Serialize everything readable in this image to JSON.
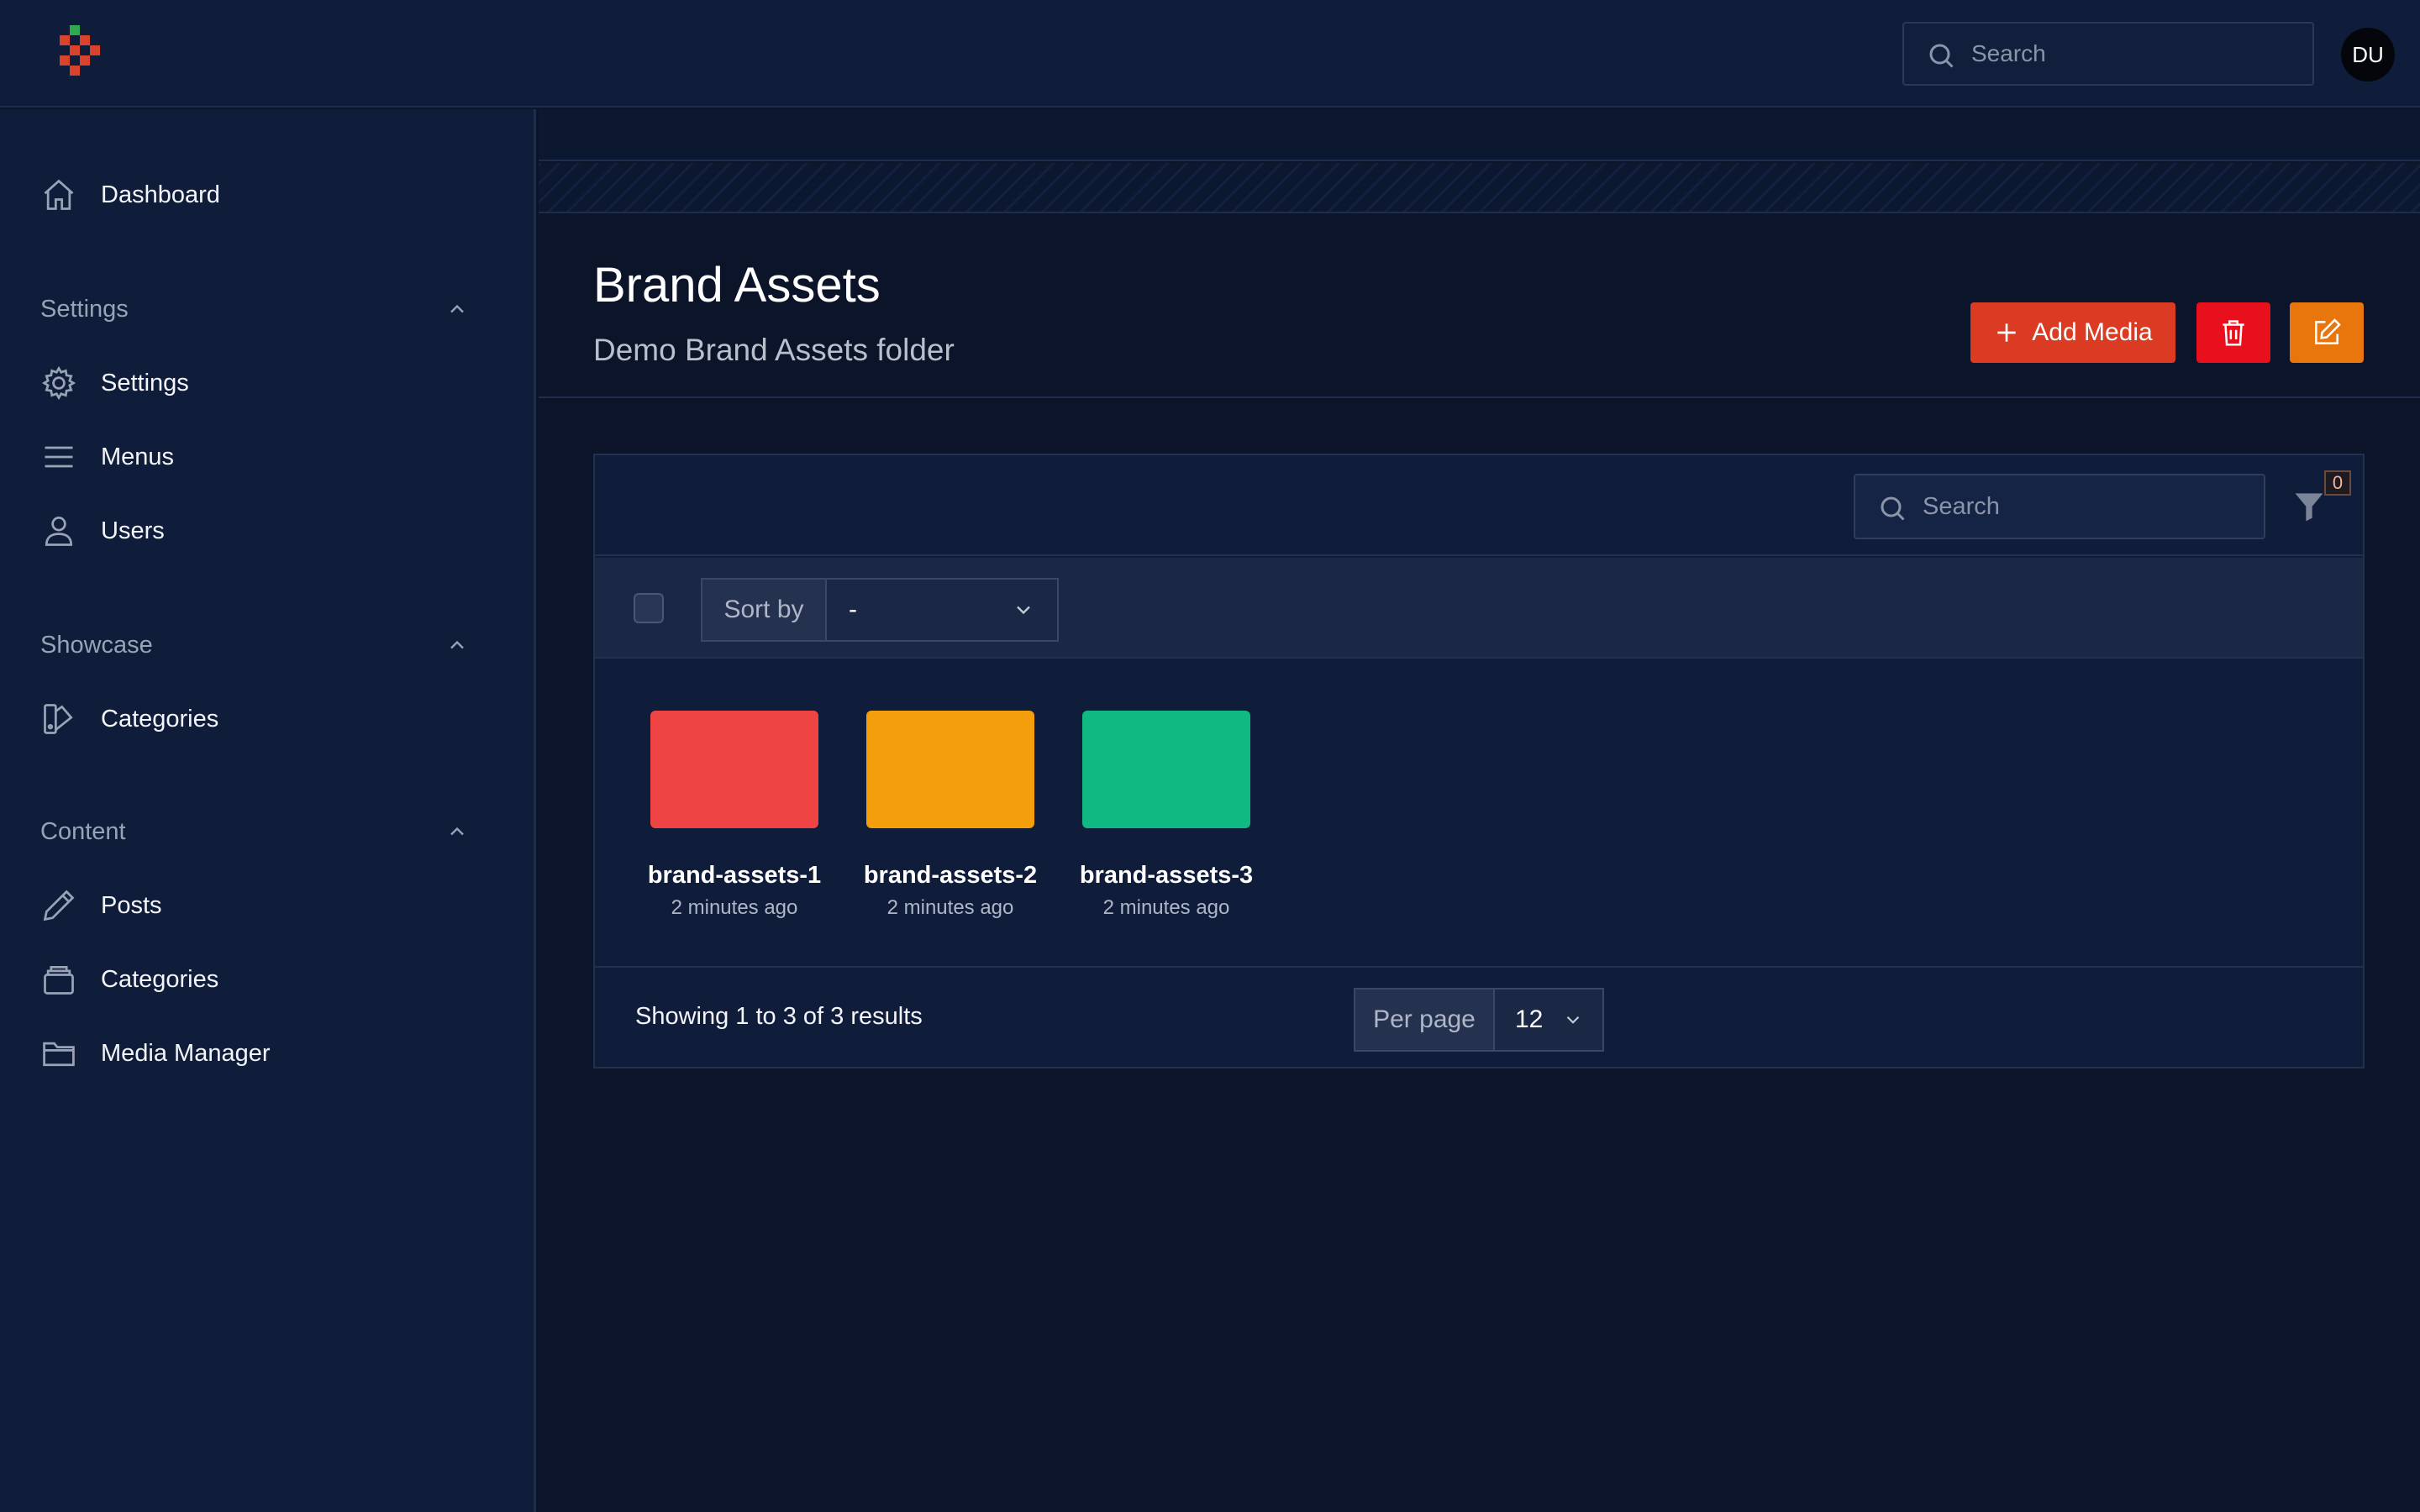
{
  "header": {
    "search_placeholder": "Search",
    "avatar_initials": "DU",
    "logo_icon": "brand-logo-icon"
  },
  "sidebar": {
    "top_items": [
      {
        "label": "Dashboard",
        "icon": "home-icon"
      }
    ],
    "groups": [
      {
        "label": "Settings",
        "items": [
          {
            "label": "Settings",
            "icon": "gear-icon"
          },
          {
            "label": "Menus",
            "icon": "menu-lines-icon"
          },
          {
            "label": "Users",
            "icon": "user-icon"
          }
        ]
      },
      {
        "label": "Showcase",
        "items": [
          {
            "label": "Categories",
            "icon": "swatch-icon"
          }
        ]
      },
      {
        "label": "Content",
        "items": [
          {
            "label": "Posts",
            "icon": "pencil-icon"
          },
          {
            "label": "Categories",
            "icon": "stack-icon"
          },
          {
            "label": "Media Manager",
            "icon": "folder-icon"
          }
        ]
      }
    ]
  },
  "page": {
    "title": "Brand Assets",
    "subtitle": "Demo Brand Assets folder",
    "add_media_label": "Add Media"
  },
  "card": {
    "search_placeholder": "Search",
    "filter_count": "0",
    "sort_label": "Sort by",
    "sort_value": "-",
    "items": [
      {
        "name": "brand-assets-1",
        "time": "2 minutes ago",
        "color": "#ef4444"
      },
      {
        "name": "brand-assets-2",
        "time": "2 minutes ago",
        "color": "#f59e0b"
      },
      {
        "name": "brand-assets-3",
        "time": "2 minutes ago",
        "color": "#10b981"
      }
    ],
    "results_text": "Showing 1 to 3 of 3 results",
    "per_page_label": "Per page",
    "per_page_value": "12"
  },
  "colors": {
    "accent_red": "#dc3b23",
    "danger": "#e8101c",
    "warning": "#e8760c",
    "background": "#0b1429",
    "sidebar": "#0f1c3a"
  }
}
